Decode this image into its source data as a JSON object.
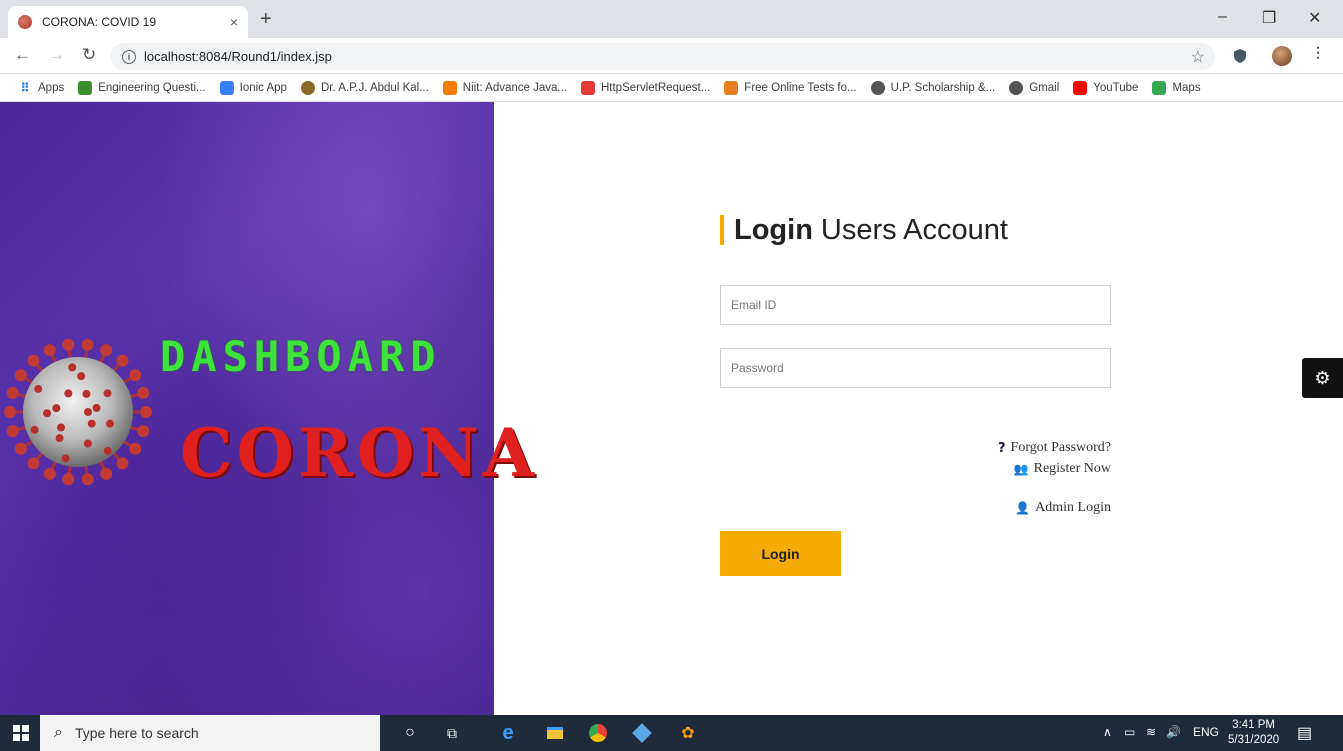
{
  "browser": {
    "tab_title": "CORONA: COVID 19",
    "tab_close": "×",
    "new_tab": "+",
    "url": "localhost:8084/Round1/index.jsp",
    "window_controls": {
      "minimize": "–",
      "maximize": "❐",
      "close": "✕"
    }
  },
  "bookmarks": [
    {
      "label": "Apps",
      "icon": "apps-grid-icon",
      "color": "#1a73e8"
    },
    {
      "label": "Engineering Questi...",
      "icon": "leaf-icon",
      "color": "#3b8d2f"
    },
    {
      "label": "Ionic App",
      "icon": "ionic-icon",
      "color": "#3880ff"
    },
    {
      "label": "Dr. A.P.J. Abdul Kal...",
      "icon": "globe-icon",
      "color": "#8a6a2b"
    },
    {
      "label": "Niit: Advance Java...",
      "icon": "blogger-icon",
      "color": "#f57c00"
    },
    {
      "label": "HttpServletRequest...",
      "icon": "oracle-icon",
      "color": "#e53935"
    },
    {
      "label": "Free Online Tests fo...",
      "icon": "test-icon",
      "color": "#e67e22"
    },
    {
      "label": "U.P. Scholarship &...",
      "icon": "globe-icon",
      "color": "#555555"
    },
    {
      "label": "Gmail",
      "icon": "globe-icon",
      "color": "#555555"
    },
    {
      "label": "YouTube",
      "icon": "youtube-icon",
      "color": "#ff0000"
    },
    {
      "label": "Maps",
      "icon": "maps-icon",
      "color": "#34a853"
    }
  ],
  "hero": {
    "title_top": "DASHBOARD",
    "title_bottom": "CORONA",
    "title_top_color": "#3de23a",
    "title_bottom_color": "#e0201e"
  },
  "login": {
    "heading_bold": "Login",
    "heading_rest": "Users Account",
    "accent_color": "#f5a800",
    "email_placeholder": "Email ID",
    "password_placeholder": "Password",
    "forgot_icon": "?",
    "forgot_label": "Forgot Password?",
    "register_icon": "👥",
    "register_label": "Register Now",
    "admin_icon": "👤",
    "admin_label": "Admin Login",
    "button_label": "Login"
  },
  "taskbar": {
    "search_placeholder": "Type here to search",
    "lang": "ENG",
    "time": "3:41 PM",
    "date": "5/31/2020"
  }
}
